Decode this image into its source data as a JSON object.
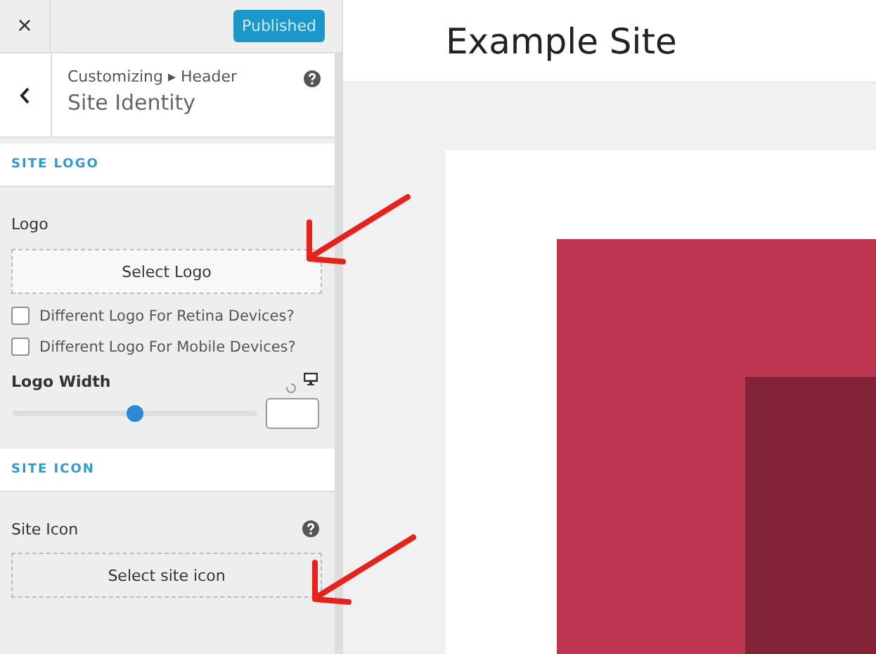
{
  "top_bar": {
    "close": "×",
    "publish_button": "Published"
  },
  "header": {
    "breadcrumb": "Customizing ▸ Header",
    "title": "Site Identity"
  },
  "sections": [
    {
      "title": "SITE LOGO"
    },
    {
      "title": "SITE ICON"
    }
  ],
  "logo": {
    "label": "Logo",
    "button": "Select Logo"
  },
  "checkboxes": [
    {
      "label": "Different Logo For Retina Devices?",
      "checked": false
    },
    {
      "label": "Different Logo For Mobile Devices?",
      "checked": false
    }
  ],
  "logo_width": {
    "label": "Logo Width",
    "level": 0.5
  },
  "site_icon": {
    "label": "Site Icon",
    "button": "Select site icon"
  },
  "preview": {
    "site_title": "Example Site"
  }
}
